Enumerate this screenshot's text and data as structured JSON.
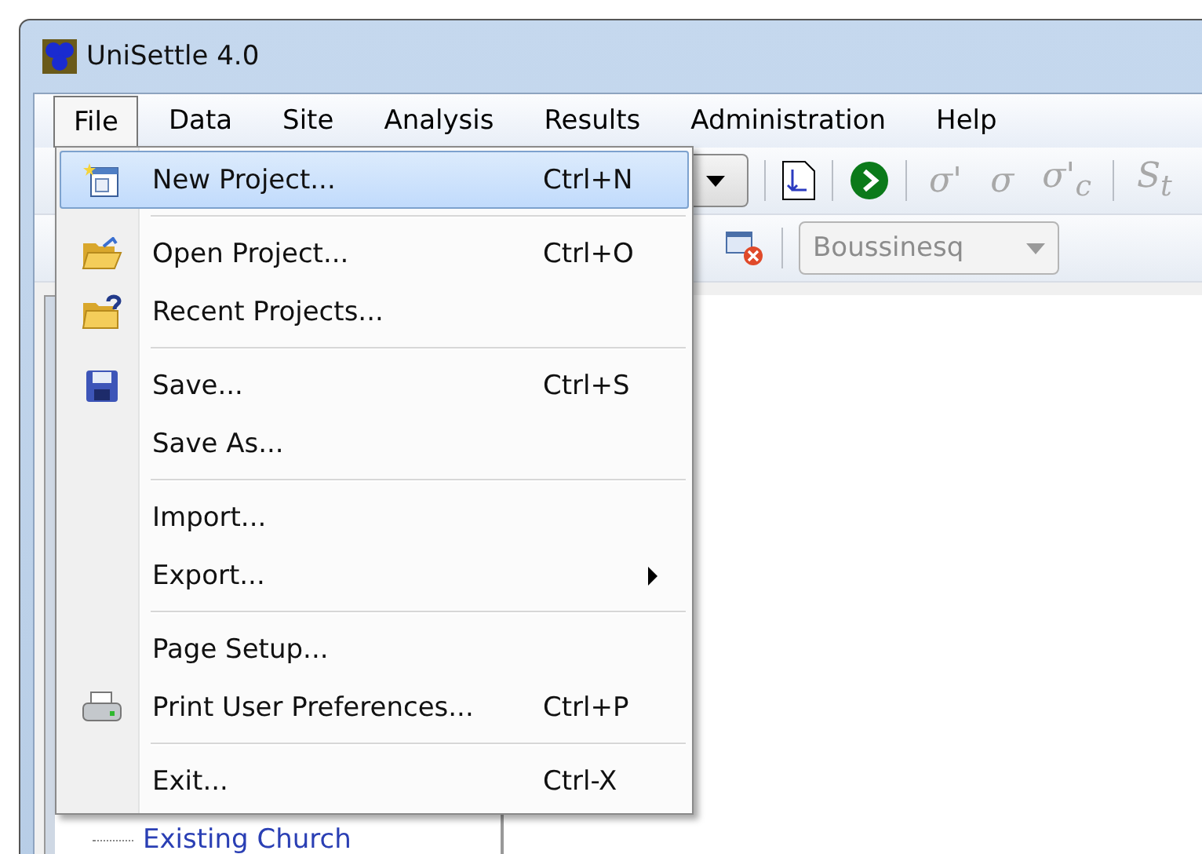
{
  "window": {
    "title": "UniSettle 4.0"
  },
  "menubar": [
    {
      "label": "File",
      "selected": true
    },
    {
      "label": "Data",
      "selected": false
    },
    {
      "label": "Site",
      "selected": false
    },
    {
      "label": "Analysis",
      "selected": false
    },
    {
      "label": "Results",
      "selected": false
    },
    {
      "label": "Administration",
      "selected": false
    },
    {
      "label": "Help",
      "selected": false
    }
  ],
  "file_menu": [
    {
      "kind": "item",
      "label": "New Project...",
      "shortcut": "Ctrl+N",
      "selected": true,
      "submenu": false
    },
    {
      "kind": "separator"
    },
    {
      "kind": "item",
      "label": "Open Project...",
      "shortcut": "Ctrl+O",
      "selected": false,
      "submenu": false
    },
    {
      "kind": "item",
      "label": "Recent Projects...",
      "selected": false,
      "submenu": false
    },
    {
      "kind": "separator"
    },
    {
      "kind": "item",
      "label": "Save...",
      "shortcut": "Ctrl+S",
      "selected": false,
      "submenu": false
    },
    {
      "kind": "item",
      "label": "Save As...",
      "selected": false,
      "submenu": false
    },
    {
      "kind": "separator"
    },
    {
      "kind": "item",
      "label": "Import...",
      "selected": false,
      "submenu": false
    },
    {
      "kind": "item",
      "label": "Export...",
      "selected": false,
      "submenu": true
    },
    {
      "kind": "separator"
    },
    {
      "kind": "item",
      "label": "Page Setup...",
      "selected": false,
      "submenu": false
    },
    {
      "kind": "item",
      "label": "Print User Preferences...",
      "shortcut": "Ctrl+P",
      "selected": false,
      "submenu": false
    },
    {
      "kind": "separator"
    },
    {
      "kind": "item",
      "label": "Exit...",
      "shortcut": "Ctrl-X",
      "selected": false,
      "submenu": false
    }
  ],
  "toolbar": {
    "stress_buttons": [
      {
        "label": "σ'",
        "disabled": true
      },
      {
        "label": "σ",
        "disabled": true
      },
      {
        "label": "σ'$_{c}$",
        "disabled": true
      },
      {
        "label": "S$_{t}$",
        "disabled": true
      }
    ],
    "method": {
      "value": "Boussinesq",
      "disabled": true
    }
  },
  "tree": {
    "items": [
      {
        "label": "Existing Church"
      }
    ]
  }
}
